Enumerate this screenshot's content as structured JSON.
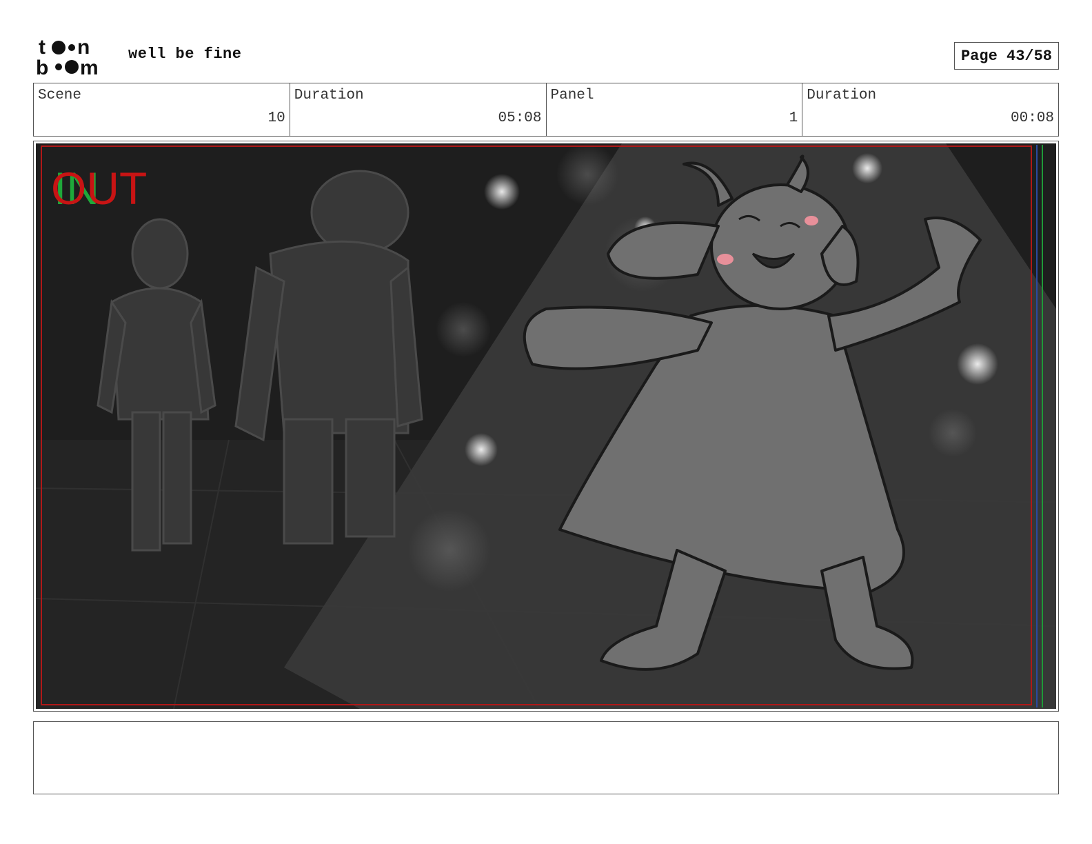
{
  "header": {
    "logo_text": "toonboom",
    "project_title": "well be fine",
    "page_label": "Page 43/58"
  },
  "info": {
    "scene_label": "Scene",
    "scene_value": "10",
    "scene_duration_label": "Duration",
    "scene_duration_value": "05:08",
    "panel_label": "Panel",
    "panel_value": "1",
    "panel_duration_label": "Duration",
    "panel_duration_value": "00:08"
  },
  "panel": {
    "marker_in": "IN",
    "marker_out": "OUT",
    "colors": {
      "background": "#1e1e1e",
      "spotlight": "#3a3a3a",
      "character_fill": "#707070",
      "outline": "#1a1a1a",
      "in_marker": "#1fa83a",
      "out_marker": "#c81414",
      "blush": "#e8909a"
    }
  },
  "notes": {
    "text": ""
  }
}
